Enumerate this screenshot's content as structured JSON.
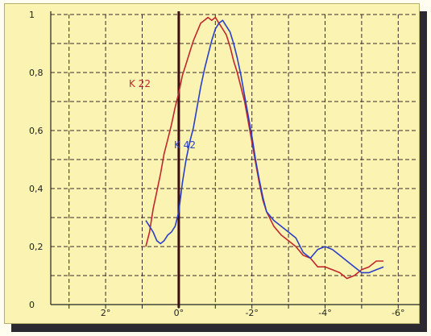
{
  "chart_data": {
    "type": "line",
    "title": "",
    "xlabel": "",
    "ylabel": "",
    "x_ticks": [
      {
        "value": 2,
        "label": "2°"
      },
      {
        "value": 0,
        "label": "0°"
      },
      {
        "value": -2,
        "label": "-2°"
      },
      {
        "value": -4,
        "label": "-4°"
      },
      {
        "value": -6,
        "label": "-6°"
      }
    ],
    "y_ticks": [
      {
        "value": 0,
        "label": "0"
      },
      {
        "value": 0.2,
        "label": "0,2"
      },
      {
        "value": 0.4,
        "label": "0,4"
      },
      {
        "value": 0.6,
        "label": "0,6"
      },
      {
        "value": 0.8,
        "label": "0,8"
      },
      {
        "value": 1,
        "label": "1"
      }
    ],
    "xlim": [
      3.5,
      -6.5
    ],
    "ylim": [
      0,
      1
    ],
    "grid": true,
    "legend": "inline labels",
    "series": [
      {
        "name": "K 22",
        "color": "#c0282d",
        "x": [
          0.9,
          0.8,
          0.7,
          0.6,
          0.5,
          0.4,
          0.3,
          0.2,
          0.1,
          0.0,
          -0.1,
          -0.2,
          -0.3,
          -0.4,
          -0.5,
          -0.6,
          -0.7,
          -0.8,
          -0.9,
          -1.0,
          -1.1,
          -1.2,
          -1.3,
          -1.4,
          -1.5,
          -1.6,
          -1.7,
          -1.8,
          -1.9,
          -2.0,
          -2.1,
          -2.2,
          -2.3,
          -2.4,
          -2.6,
          -2.8,
          -3.0,
          -3.2,
          -3.4,
          -3.6,
          -3.8,
          -4.0,
          -4.2,
          -4.4,
          -4.6,
          -4.8,
          -5.0,
          -5.2,
          -5.4,
          -5.6
        ],
        "y": [
          0.2,
          0.25,
          0.33,
          0.39,
          0.45,
          0.52,
          0.57,
          0.62,
          0.68,
          0.73,
          0.79,
          0.83,
          0.87,
          0.91,
          0.94,
          0.97,
          0.98,
          0.99,
          0.98,
          0.99,
          0.97,
          0.95,
          0.93,
          0.89,
          0.84,
          0.8,
          0.75,
          0.7,
          0.63,
          0.56,
          0.49,
          0.42,
          0.36,
          0.32,
          0.27,
          0.24,
          0.22,
          0.2,
          0.17,
          0.16,
          0.13,
          0.13,
          0.12,
          0.11,
          0.09,
          0.1,
          0.12,
          0.13,
          0.15,
          0.15
        ]
      },
      {
        "name": "K 42",
        "color": "#2a3fc8",
        "x": [
          0.9,
          0.8,
          0.7,
          0.6,
          0.5,
          0.4,
          0.3,
          0.2,
          0.1,
          0.0,
          -0.1,
          -0.2,
          -0.3,
          -0.4,
          -0.5,
          -0.6,
          -0.7,
          -0.8,
          -0.9,
          -1.0,
          -1.1,
          -1.2,
          -1.3,
          -1.4,
          -1.5,
          -1.6,
          -1.7,
          -1.8,
          -1.9,
          -2.0,
          -2.1,
          -2.2,
          -2.3,
          -2.4,
          -2.6,
          -2.8,
          -3.0,
          -3.2,
          -3.4,
          -3.6,
          -3.8,
          -4.0,
          -4.2,
          -4.4,
          -4.6,
          -4.8,
          -5.0,
          -5.2,
          -5.4,
          -5.6
        ],
        "y": [
          0.29,
          0.27,
          0.25,
          0.22,
          0.21,
          0.22,
          0.24,
          0.25,
          0.27,
          0.32,
          0.42,
          0.5,
          0.56,
          0.61,
          0.68,
          0.75,
          0.81,
          0.86,
          0.91,
          0.95,
          0.97,
          0.98,
          0.96,
          0.94,
          0.9,
          0.85,
          0.79,
          0.72,
          0.65,
          0.58,
          0.5,
          0.43,
          0.37,
          0.32,
          0.29,
          0.27,
          0.25,
          0.23,
          0.18,
          0.16,
          0.19,
          0.2,
          0.19,
          0.17,
          0.15,
          0.13,
          0.11,
          0.11,
          0.12,
          0.13
        ]
      }
    ]
  }
}
